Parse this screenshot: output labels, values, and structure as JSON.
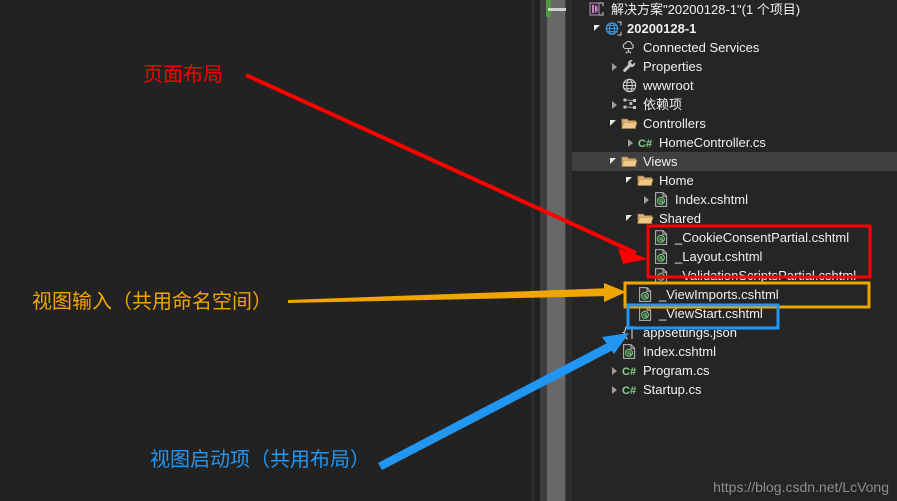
{
  "window": {
    "background": "#212121",
    "tree_background": "#252526",
    "scrollbar_color": "#686868"
  },
  "watermark": {
    "text": "https://blog.csdn.net/LcVong",
    "color": "#8d8d8d"
  },
  "solution_explorer": {
    "rows": [
      {
        "label": "解决方案\"20200128-1\"(1 个项目)",
        "indent": 0,
        "expander": "none",
        "icon": "visual-studio-solution-icon",
        "bold": false,
        "selected": false
      },
      {
        "label": "20200128-1",
        "indent": 1,
        "expander": "expanded",
        "icon": "web-project-globe-icon",
        "bold": true,
        "selected": false
      },
      {
        "label": "Connected Services",
        "indent": 2,
        "expander": "none",
        "icon": "connected-services-cloud-icon",
        "bold": false,
        "selected": false
      },
      {
        "label": "Properties",
        "indent": 2,
        "expander": "collapsed",
        "icon": "wrench-properties-icon",
        "bold": false,
        "selected": false
      },
      {
        "label": "wwwroot",
        "indent": 2,
        "expander": "none",
        "icon": "globe-wwwroot-icon",
        "bold": false,
        "selected": false
      },
      {
        "label": "依赖项",
        "indent": 2,
        "expander": "collapsed",
        "icon": "dependencies-icon",
        "bold": false,
        "selected": false
      },
      {
        "label": "Controllers",
        "indent": 2,
        "expander": "expanded",
        "icon": "folder-icon",
        "bold": false,
        "selected": false
      },
      {
        "label": "HomeController.cs",
        "indent": 3,
        "expander": "collapsed",
        "icon": "csharp-file-icon",
        "bold": false,
        "selected": false
      },
      {
        "label": "Views",
        "indent": 2,
        "expander": "expanded",
        "icon": "folder-icon",
        "bold": false,
        "selected": true
      },
      {
        "label": "Home",
        "indent": 3,
        "expander": "expanded",
        "icon": "folder-icon",
        "bold": false,
        "selected": false
      },
      {
        "label": "Index.cshtml",
        "indent": 4,
        "expander": "collapsed",
        "icon": "cshtml-file-icon",
        "bold": false,
        "selected": false
      },
      {
        "label": "Shared",
        "indent": 3,
        "expander": "expanded",
        "icon": "folder-icon",
        "bold": false,
        "selected": false
      },
      {
        "label": "_CookieConsentPartial.cshtml",
        "indent": 4,
        "expander": "none",
        "icon": "cshtml-file-icon",
        "bold": false,
        "selected": false
      },
      {
        "label": "_Layout.cshtml",
        "indent": 4,
        "expander": "none",
        "icon": "cshtml-file-icon",
        "bold": false,
        "selected": false
      },
      {
        "label": "_ValidationScriptsPartial.cshtml",
        "indent": 4,
        "expander": "none",
        "icon": "cshtml-file-icon",
        "bold": false,
        "selected": false
      },
      {
        "label": "_ViewImports.cshtml",
        "indent": 3,
        "expander": "none",
        "icon": "cshtml-file-icon",
        "bold": false,
        "selected": false
      },
      {
        "label": "_ViewStart.cshtml",
        "indent": 3,
        "expander": "none",
        "icon": "cshtml-file-icon",
        "bold": false,
        "selected": false
      },
      {
        "label": "appsettings.json",
        "indent": 2,
        "expander": "none",
        "icon": "json-file-icon",
        "bold": false,
        "selected": false
      },
      {
        "label": "Index.cshtml",
        "indent": 2,
        "expander": "none",
        "icon": "cshtml-file-icon",
        "bold": false,
        "selected": false
      },
      {
        "label": "Program.cs",
        "indent": 2,
        "expander": "collapsed",
        "icon": "csharp-file-icon",
        "bold": false,
        "selected": false
      },
      {
        "label": "Startup.cs",
        "indent": 2,
        "expander": "collapsed",
        "icon": "csharp-file-icon",
        "bold": false,
        "selected": false
      }
    ]
  },
  "annotations": [
    {
      "id": "layout",
      "text": "页面布局",
      "color": "#ff0000",
      "target_rows": [
        "_CookieConsentPartial.cshtml",
        "_Layout.cshtml",
        "_ValidationScriptsPartial.cshtml"
      ]
    },
    {
      "id": "view-imports",
      "text": "视图输入（共用命名空间）",
      "color": "#f0a500",
      "target_rows": [
        "_ViewImports.cshtml"
      ]
    },
    {
      "id": "view-start",
      "text": "视图启动项（共用布局）",
      "color": "#2196f3",
      "target_rows": [
        "_ViewStart.cshtml"
      ]
    }
  ]
}
